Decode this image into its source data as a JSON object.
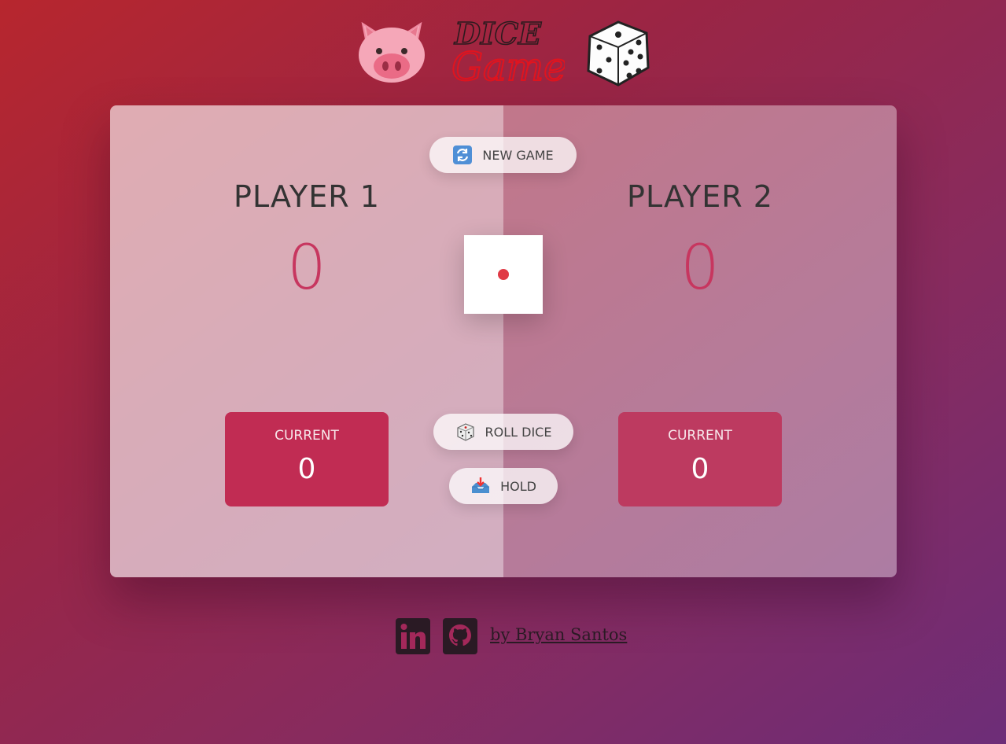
{
  "header": {
    "logo_line1": "DICE",
    "logo_line2": "Game"
  },
  "game": {
    "new_game_label": "NEW GAME",
    "roll_dice_label": "ROLL DICE",
    "hold_label": "HOLD",
    "dice_value": 1,
    "players": [
      {
        "name": "PLAYER 1",
        "score": "0",
        "current_label": "CURRENT",
        "current_score": "0"
      },
      {
        "name": "PLAYER 2",
        "score": "0",
        "current_label": "CURRENT",
        "current_score": "0"
      }
    ]
  },
  "footer": {
    "credit": "by Bryan Santos"
  },
  "icons": {
    "new_game": "refresh-icon",
    "roll_dice": "dice-icon",
    "hold": "inbox-tray-icon",
    "linkedin": "linkedin-icon",
    "github": "github-icon"
  },
  "colors": {
    "score": "#c7365f",
    "current_box": "#c12c53",
    "dice_dot": "#e03a45"
  }
}
